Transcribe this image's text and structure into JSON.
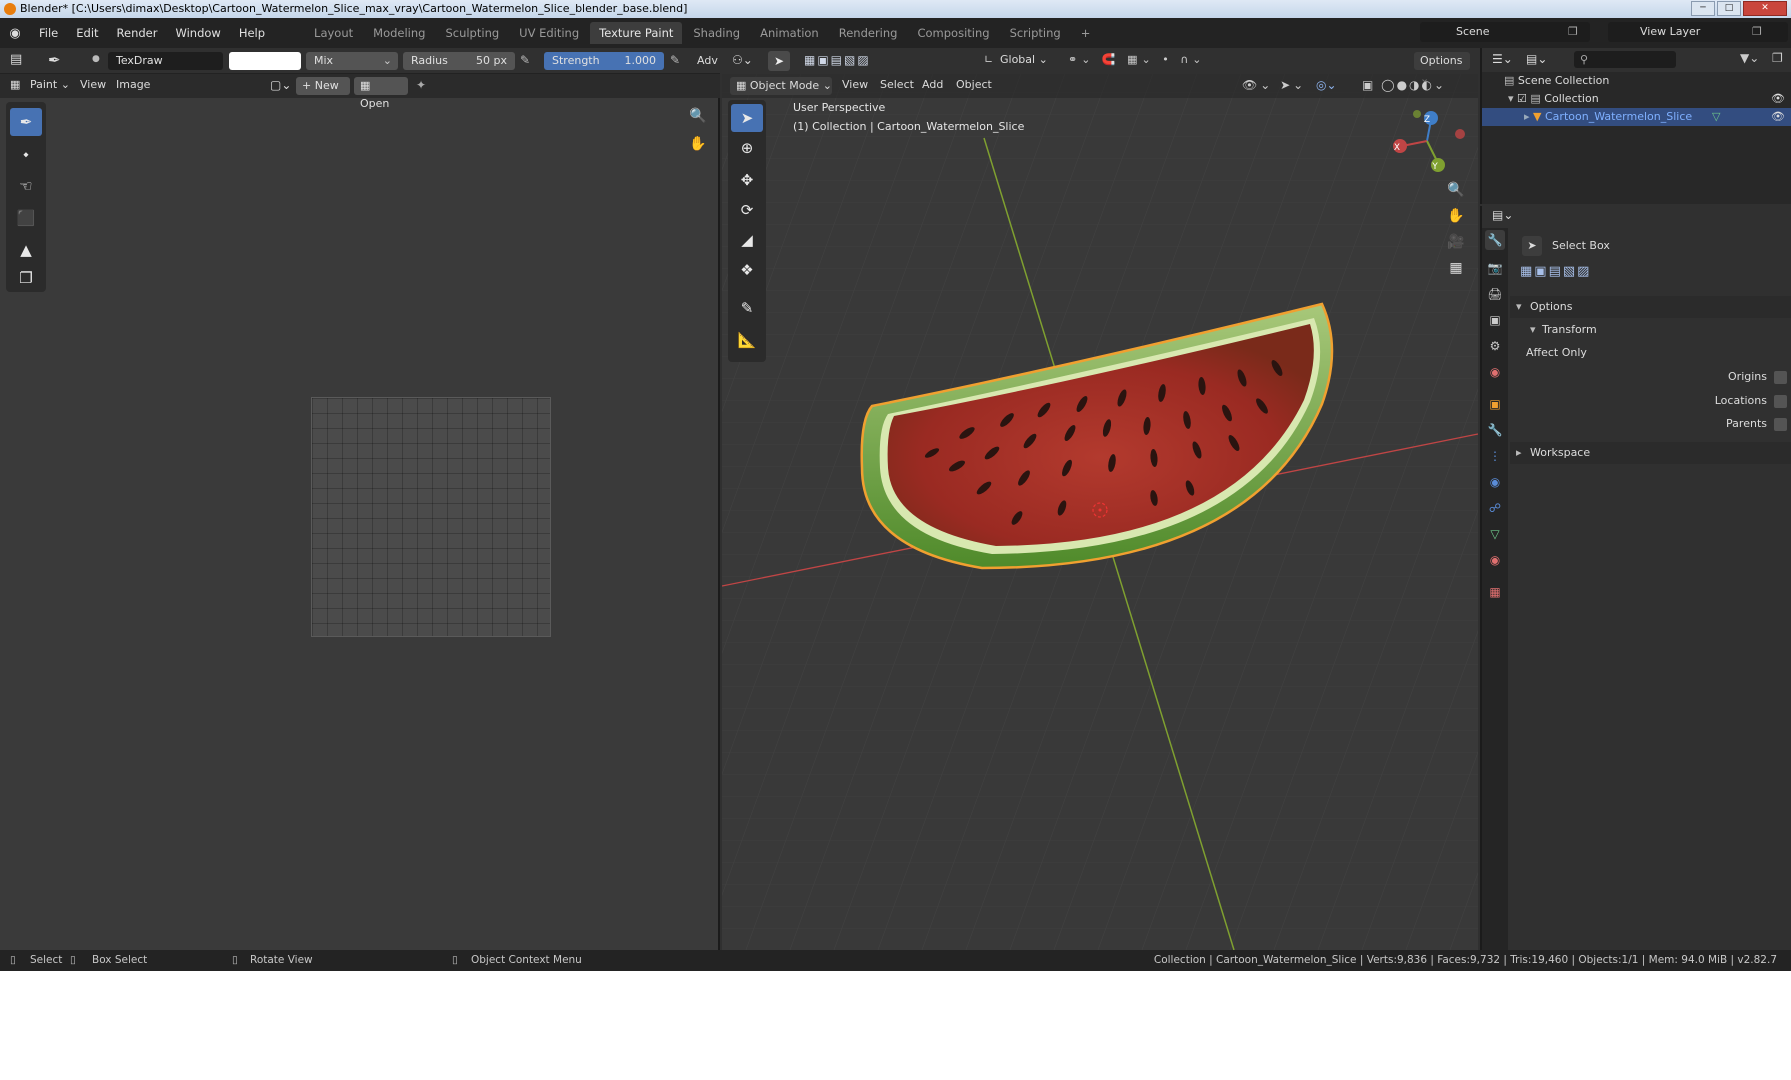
{
  "window": {
    "title": "Blender* [C:\\Users\\dimax\\Desktop\\Cartoon_Watermelon_Slice_max_vray\\Cartoon_Watermelon_Slice_blender_base.blend]",
    "controls": [
      "─",
      "□",
      "✕"
    ]
  },
  "menu": [
    "File",
    "Edit",
    "Render",
    "Window",
    "Help"
  ],
  "workspaces": [
    {
      "label": "Layout",
      "active": false
    },
    {
      "label": "Modeling",
      "active": false
    },
    {
      "label": "Sculpting",
      "active": false
    },
    {
      "label": "UV Editing",
      "active": false
    },
    {
      "label": "Texture Paint",
      "active": true
    },
    {
      "label": "Shading",
      "active": false
    },
    {
      "label": "Animation",
      "active": false
    },
    {
      "label": "Rendering",
      "active": false
    },
    {
      "label": "Compositing",
      "active": false
    },
    {
      "label": "Scripting",
      "active": false
    }
  ],
  "add_workspace": "+",
  "scene": "Scene",
  "view_layer": "View Layer",
  "image_editor": {
    "brush_name": "TexDraw",
    "blend_mode": "Mix",
    "radius_label": "Radius",
    "radius_value": "50 px",
    "strength_label": "Strength",
    "strength_value": "1.000",
    "adv_label": "Adv",
    "mode": "Paint",
    "menus": [
      "View",
      "Image"
    ],
    "new_label": "New",
    "open_label": "Open"
  },
  "viewport": {
    "snap_orientation": "Global",
    "options_label": "Options",
    "mode": "Object Mode",
    "menus": [
      "View",
      "Select",
      "Add",
      "Object"
    ],
    "perspective": "User Perspective",
    "collection_info": "(1) Collection | Cartoon_Watermelon_Slice",
    "gizmo_axes": [
      "X",
      "Y",
      "Z"
    ]
  },
  "outliner": {
    "scene_collection": "Scene Collection",
    "collection": "Collection",
    "object": "Cartoon_Watermelon_Slice"
  },
  "properties": {
    "tool_name": "Select Box",
    "options_label": "Options",
    "transform_label": "Transform",
    "affect_only_label": "Affect Only",
    "origins_label": "Origins",
    "locations_label": "Locations",
    "parents_label": "Parents",
    "workspace_label": "Workspace"
  },
  "statusbar": {
    "select": "Select",
    "box_select": "Box Select",
    "rotate_view": "Rotate View",
    "context_menu": "Object Context Menu",
    "stats": "Collection | Cartoon_Watermelon_Slice | Verts:9,836 | Faces:9,732 | Tris:19,460 | Objects:1/1 | Mem: 94.0 MiB | v2.82.7"
  },
  "colors": {
    "accent": "#4772b3",
    "selected_outline": "#f0a030",
    "axis_x": "#c04545",
    "axis_y": "#7fa030"
  }
}
